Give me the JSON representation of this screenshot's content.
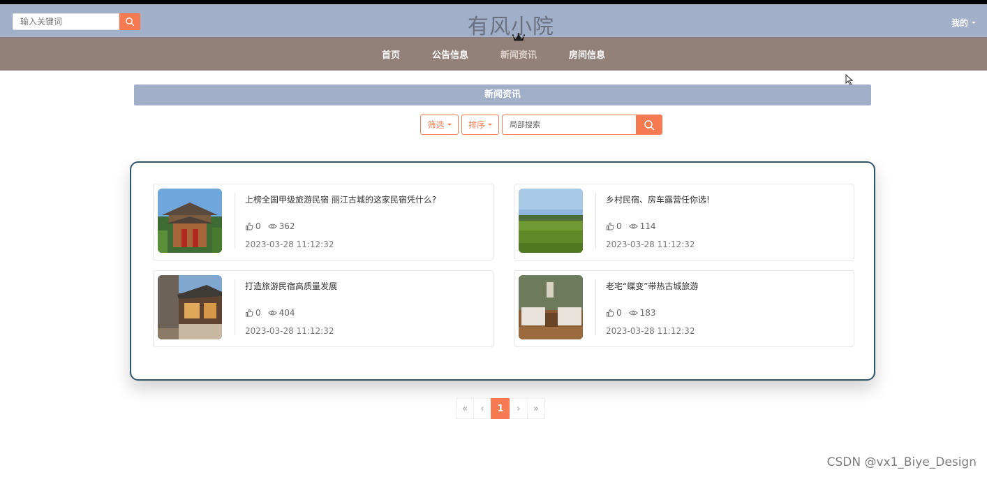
{
  "header": {
    "search_placeholder": "输入关键词",
    "site_title": "有风小院",
    "user_menu": "我的"
  },
  "nav": {
    "items": [
      {
        "label": "首页"
      },
      {
        "label": "公告信息"
      },
      {
        "label": "新闻资讯"
      },
      {
        "label": "房间信息"
      }
    ],
    "active_index": 2
  },
  "section": {
    "title": "新闻资讯",
    "filter_label": "筛选",
    "sort_label": "排序",
    "search_placeholder": "局部搜索"
  },
  "news": [
    {
      "title": "上榜全国甲级旅游民宿 丽江古城的这家民宿凭什么?",
      "likes": "0",
      "views": "362",
      "date": "2023-03-28 11:12:32",
      "thumb": "ancient-courtyard-inn"
    },
    {
      "title": "乡村民宿、房车露营任你选!",
      "likes": "0",
      "views": "114",
      "date": "2023-03-28 11:12:32",
      "thumb": "green-rice-field"
    },
    {
      "title": "打造旅游民宿高质量发展",
      "likes": "0",
      "views": "404",
      "date": "2023-03-28 11:12:32",
      "thumb": "stone-wood-cabin"
    },
    {
      "title": "老宅“蝶变”带热古城旅游",
      "likes": "0",
      "views": "183",
      "date": "2023-03-28 11:12:32",
      "thumb": "twin-bed-room"
    }
  ],
  "pagination": {
    "first": "«",
    "prev": "‹",
    "current": "1",
    "next": "›",
    "last": "»"
  },
  "watermark": "CSDN @vx1_Biye_Design",
  "colors": {
    "header_bg": "#a2afc9",
    "nav_bg": "#938078",
    "accent": "#f67a52",
    "panel_border": "#2e5763"
  }
}
